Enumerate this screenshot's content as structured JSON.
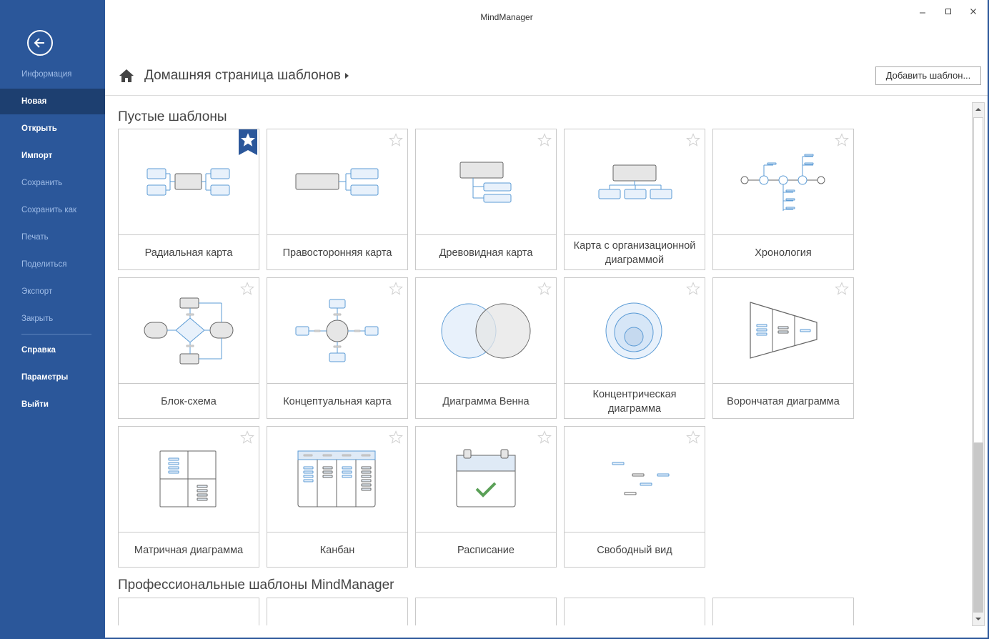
{
  "app": {
    "title": "MindManager"
  },
  "sidebar": {
    "items": [
      {
        "label": "Информация",
        "state": "muted"
      },
      {
        "label": "Новая",
        "state": "selected"
      },
      {
        "label": "Открыть",
        "state": "normal"
      },
      {
        "label": "Импорт",
        "state": "normal"
      },
      {
        "label": "Сохранить",
        "state": "muted"
      },
      {
        "label": "Сохранить как",
        "state": "muted"
      },
      {
        "label": "Печать",
        "state": "muted"
      },
      {
        "label": "Поделиться",
        "state": "muted"
      },
      {
        "label": "Экспорт",
        "state": "muted"
      },
      {
        "label": "Закрыть",
        "state": "muted"
      },
      {
        "label": "Справка",
        "state": "normal"
      },
      {
        "label": "Параметры",
        "state": "normal"
      },
      {
        "label": "Выйти",
        "state": "normal"
      }
    ]
  },
  "header": {
    "breadcrumb": "Домашняя страница шаблонов",
    "add_template_label": "Добавить шаблон..."
  },
  "sections": {
    "blank": {
      "title": "Пустые шаблоны",
      "cards": [
        {
          "label": "Радиальная карта",
          "icon": "radial-map-icon",
          "favorite": true
        },
        {
          "label": "Правосторонняя карта",
          "icon": "right-map-icon",
          "favorite": false
        },
        {
          "label": "Древовидная карта",
          "icon": "tree-map-icon",
          "favorite": false
        },
        {
          "label": "Карта с организационной диаграммой",
          "icon": "org-chart-icon",
          "favorite": false
        },
        {
          "label": "Хронология",
          "icon": "timeline-icon",
          "favorite": false
        },
        {
          "label": "Блок-схема",
          "icon": "flowchart-icon",
          "favorite": false
        },
        {
          "label": "Концептуальная карта",
          "icon": "concept-map-icon",
          "favorite": false
        },
        {
          "label": "Диаграмма Венна",
          "icon": "venn-icon",
          "favorite": false
        },
        {
          "label": "Концентрическая диаграмма",
          "icon": "concentric-icon",
          "favorite": false
        },
        {
          "label": "Воронча­тая диаграмма",
          "icon": "funnel-icon",
          "favorite": false
        },
        {
          "label": "Матричная диаграмма",
          "icon": "matrix-icon",
          "favorite": false
        },
        {
          "label": "Канбан",
          "icon": "kanban-icon",
          "favorite": false
        },
        {
          "label": "Расписание",
          "icon": "schedule-icon",
          "favorite": false
        },
        {
          "label": "Свободный вид",
          "icon": "freeform-icon",
          "favorite": false
        }
      ]
    },
    "pro": {
      "title": "Профессиональные шаблоны MindManager"
    }
  },
  "colors": {
    "sidebar_bg": "#2b579a",
    "sidebar_selected": "#1d3f70",
    "accent_blue": "#2b579a",
    "diagram_blue": "#5b9bd5",
    "diagram_gray": "#e6e6e6"
  }
}
